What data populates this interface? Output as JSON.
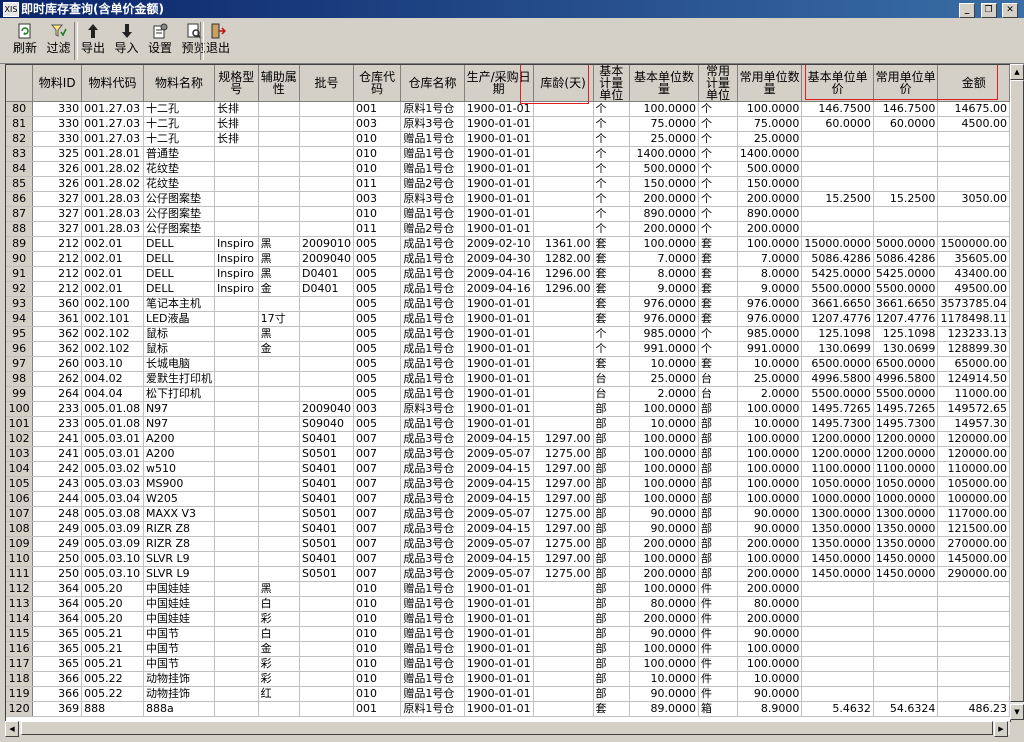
{
  "window": {
    "app_icon": "XIS",
    "title": "即时库存查询(含单价金额)",
    "buttons": {
      "minimize": "_",
      "restore": "❐",
      "close": "✕"
    }
  },
  "toolbar": {
    "refresh": {
      "label": "刷新",
      "icon": "refresh-icon"
    },
    "filter": {
      "label": "过滤",
      "icon": "filter-icon"
    },
    "export": {
      "label": "导出",
      "icon": "export-icon"
    },
    "import": {
      "label": "导入",
      "icon": "import-icon"
    },
    "settings": {
      "label": "设置",
      "icon": "settings-icon"
    },
    "preview": {
      "label": "预览",
      "icon": "preview-icon"
    },
    "exit": {
      "label": "退出",
      "icon": "exit-icon"
    }
  },
  "table": {
    "highlight_color": "#e02020",
    "headers": [
      "物料ID",
      "物料代码",
      "物料名称",
      "规格型号",
      "辅助属性",
      "批号",
      "仓库代码",
      "仓库名称",
      "生产/采购日期",
      "库龄(天)",
      "基本计量单位",
      "基本单位数量",
      "常用计量单位",
      "常用单位数量",
      "基本单位单价",
      "常用单位单价",
      "金额"
    ],
    "rows": [
      [
        "80",
        "330",
        "001.27.03",
        "十二孔",
        "长排",
        "",
        "",
        "001",
        "原料1号仓",
        "1900-01-01",
        "",
        "个",
        "100.0000",
        "个",
        "100.0000",
        "146.7500",
        "146.7500",
        "14675.00"
      ],
      [
        "81",
        "330",
        "001.27.03",
        "十二孔",
        "长排",
        "",
        "",
        "003",
        "原料3号仓",
        "1900-01-01",
        "",
        "个",
        "75.0000",
        "个",
        "75.0000",
        "60.0000",
        "60.0000",
        "4500.00"
      ],
      [
        "82",
        "330",
        "001.27.03",
        "十二孔",
        "长排",
        "",
        "",
        "010",
        "赠品1号仓",
        "1900-01-01",
        "",
        "个",
        "25.0000",
        "个",
        "25.0000",
        "",
        "",
        ""
      ],
      [
        "83",
        "325",
        "001.28.01",
        "普通垫",
        "",
        "",
        "",
        "010",
        "赠品1号仓",
        "1900-01-01",
        "",
        "个",
        "1400.0000",
        "个",
        "1400.0000",
        "",
        "",
        ""
      ],
      [
        "84",
        "326",
        "001.28.02",
        "花纹垫",
        "",
        "",
        "",
        "010",
        "赠品1号仓",
        "1900-01-01",
        "",
        "个",
        "500.0000",
        "个",
        "500.0000",
        "",
        "",
        ""
      ],
      [
        "85",
        "326",
        "001.28.02",
        "花纹垫",
        "",
        "",
        "",
        "011",
        "赠品2号仓",
        "1900-01-01",
        "",
        "个",
        "150.0000",
        "个",
        "150.0000",
        "",
        "",
        ""
      ],
      [
        "86",
        "327",
        "001.28.03",
        "公仔图案垫",
        "",
        "",
        "",
        "003",
        "原料3号仓",
        "1900-01-01",
        "",
        "个",
        "200.0000",
        "个",
        "200.0000",
        "15.2500",
        "15.2500",
        "3050.00"
      ],
      [
        "87",
        "327",
        "001.28.03",
        "公仔图案垫",
        "",
        "",
        "",
        "010",
        "赠品1号仓",
        "1900-01-01",
        "",
        "个",
        "890.0000",
        "个",
        "890.0000",
        "",
        "",
        ""
      ],
      [
        "88",
        "327",
        "001.28.03",
        "公仔图案垫",
        "",
        "",
        "",
        "011",
        "赠品2号仓",
        "1900-01-01",
        "",
        "个",
        "200.0000",
        "个",
        "200.0000",
        "",
        "",
        ""
      ],
      [
        "89",
        "212",
        "002.01",
        "DELL",
        "Inspiro",
        "黑",
        "2009010",
        "005",
        "成品1号仓",
        "2009-02-10",
        "1361.00",
        "套",
        "100.0000",
        "套",
        "100.0000",
        "15000.0000",
        "5000.0000",
        "1500000.00"
      ],
      [
        "90",
        "212",
        "002.01",
        "DELL",
        "Inspiro",
        "黑",
        "2009040",
        "005",
        "成品1号仓",
        "2009-04-30",
        "1282.00",
        "套",
        "7.0000",
        "套",
        "7.0000",
        "5086.4286",
        "5086.4286",
        "35605.00"
      ],
      [
        "91",
        "212",
        "002.01",
        "DELL",
        "Inspiro",
        "黑",
        "D0401",
        "005",
        "成品1号仓",
        "2009-04-16",
        "1296.00",
        "套",
        "8.0000",
        "套",
        "8.0000",
        "5425.0000",
        "5425.0000",
        "43400.00"
      ],
      [
        "92",
        "212",
        "002.01",
        "DELL",
        "Inspiro",
        "金",
        "D0401",
        "005",
        "成品1号仓",
        "2009-04-16",
        "1296.00",
        "套",
        "9.0000",
        "套",
        "9.0000",
        "5500.0000",
        "5500.0000",
        "49500.00"
      ],
      [
        "93",
        "360",
        "002.100",
        "笔记本主机",
        "",
        "",
        "",
        "005",
        "成品1号仓",
        "1900-01-01",
        "",
        "套",
        "976.0000",
        "套",
        "976.0000",
        "3661.6650",
        "3661.6650",
        "3573785.04"
      ],
      [
        "94",
        "361",
        "002.101",
        "LED液晶",
        "",
        "17寸",
        "",
        "005",
        "成品1号仓",
        "1900-01-01",
        "",
        "套",
        "976.0000",
        "套",
        "976.0000",
        "1207.4776",
        "1207.4776",
        "1178498.11"
      ],
      [
        "95",
        "362",
        "002.102",
        "鼠标",
        "",
        "黑",
        "",
        "005",
        "成品1号仓",
        "1900-01-01",
        "",
        "个",
        "985.0000",
        "个",
        "985.0000",
        "125.1098",
        "125.1098",
        "123233.13"
      ],
      [
        "96",
        "362",
        "002.102",
        "鼠标",
        "",
        "金",
        "",
        "005",
        "成品1号仓",
        "1900-01-01",
        "",
        "个",
        "991.0000",
        "个",
        "991.0000",
        "130.0699",
        "130.0699",
        "128899.30"
      ],
      [
        "97",
        "260",
        "003.10",
        "长城电脑",
        "",
        "",
        "",
        "005",
        "成品1号仓",
        "1900-01-01",
        "",
        "套",
        "10.0000",
        "套",
        "10.0000",
        "6500.0000",
        "6500.0000",
        "65000.00"
      ],
      [
        "98",
        "262",
        "004.02",
        "爱默生打印机",
        "",
        "",
        "",
        "005",
        "成品1号仓",
        "1900-01-01",
        "",
        "台",
        "25.0000",
        "台",
        "25.0000",
        "4996.5800",
        "4996.5800",
        "124914.50"
      ],
      [
        "99",
        "264",
        "004.04",
        "松下打印机",
        "",
        "",
        "",
        "005",
        "成品1号仓",
        "1900-01-01",
        "",
        "台",
        "2.0000",
        "台",
        "2.0000",
        "5500.0000",
        "5500.0000",
        "11000.00"
      ],
      [
        "100",
        "233",
        "005.01.08",
        "N97",
        "",
        "",
        "2009040",
        "003",
        "原料3号仓",
        "1900-01-01",
        "",
        "部",
        "100.0000",
        "部",
        "100.0000",
        "1495.7265",
        "1495.7265",
        "149572.65"
      ],
      [
        "101",
        "233",
        "005.01.08",
        "N97",
        "",
        "",
        "S09040",
        "005",
        "成品1号仓",
        "1900-01-01",
        "",
        "部",
        "10.0000",
        "部",
        "10.0000",
        "1495.7300",
        "1495.7300",
        "14957.30"
      ],
      [
        "102",
        "241",
        "005.03.01",
        "A200",
        "",
        "",
        "S0401",
        "007",
        "成品3号仓",
        "2009-04-15",
        "1297.00",
        "部",
        "100.0000",
        "部",
        "100.0000",
        "1200.0000",
        "1200.0000",
        "120000.00"
      ],
      [
        "103",
        "241",
        "005.03.01",
        "A200",
        "",
        "",
        "S0501",
        "007",
        "成品3号仓",
        "2009-05-07",
        "1275.00",
        "部",
        "100.0000",
        "部",
        "100.0000",
        "1200.0000",
        "1200.0000",
        "120000.00"
      ],
      [
        "104",
        "242",
        "005.03.02",
        "w510",
        "",
        "",
        "S0401",
        "007",
        "成品3号仓",
        "2009-04-15",
        "1297.00",
        "部",
        "100.0000",
        "部",
        "100.0000",
        "1100.0000",
        "1100.0000",
        "110000.00"
      ],
      [
        "105",
        "243",
        "005.03.03",
        "MS900",
        "",
        "",
        "S0401",
        "007",
        "成品3号仓",
        "2009-04-15",
        "1297.00",
        "部",
        "100.0000",
        "部",
        "100.0000",
        "1050.0000",
        "1050.0000",
        "105000.00"
      ],
      [
        "106",
        "244",
        "005.03.04",
        "W205",
        "",
        "",
        "S0401",
        "007",
        "成品3号仓",
        "2009-04-15",
        "1297.00",
        "部",
        "100.0000",
        "部",
        "100.0000",
        "1000.0000",
        "1000.0000",
        "100000.00"
      ],
      [
        "107",
        "248",
        "005.03.08",
        "MAXX V3",
        "",
        "",
        "S0501",
        "007",
        "成品3号仓",
        "2009-05-07",
        "1275.00",
        "部",
        "90.0000",
        "部",
        "90.0000",
        "1300.0000",
        "1300.0000",
        "117000.00"
      ],
      [
        "108",
        "249",
        "005.03.09",
        "RIZR Z8",
        "",
        "",
        "S0401",
        "007",
        "成品3号仓",
        "2009-04-15",
        "1297.00",
        "部",
        "90.0000",
        "部",
        "90.0000",
        "1350.0000",
        "1350.0000",
        "121500.00"
      ],
      [
        "109",
        "249",
        "005.03.09",
        "RIZR Z8",
        "",
        "",
        "S0501",
        "007",
        "成品3号仓",
        "2009-05-07",
        "1275.00",
        "部",
        "200.0000",
        "部",
        "200.0000",
        "1350.0000",
        "1350.0000",
        "270000.00"
      ],
      [
        "110",
        "250",
        "005.03.10",
        "SLVR L9",
        "",
        "",
        "S0401",
        "007",
        "成品3号仓",
        "2009-04-15",
        "1297.00",
        "部",
        "100.0000",
        "部",
        "100.0000",
        "1450.0000",
        "1450.0000",
        "145000.00"
      ],
      [
        "111",
        "250",
        "005.03.10",
        "SLVR L9",
        "",
        "",
        "S0501",
        "007",
        "成品3号仓",
        "2009-05-07",
        "1275.00",
        "部",
        "200.0000",
        "部",
        "200.0000",
        "1450.0000",
        "1450.0000",
        "290000.00"
      ],
      [
        "112",
        "364",
        "005.20",
        "中国娃娃",
        "",
        "黑",
        "",
        "010",
        "赠品1号仓",
        "1900-01-01",
        "",
        "部",
        "100.0000",
        "件",
        "200.0000",
        "",
        "",
        ""
      ],
      [
        "113",
        "364",
        "005.20",
        "中国娃娃",
        "",
        "白",
        "",
        "010",
        "赠品1号仓",
        "1900-01-01",
        "",
        "部",
        "80.0000",
        "件",
        "80.0000",
        "",
        "",
        ""
      ],
      [
        "114",
        "364",
        "005.20",
        "中国娃娃",
        "",
        "彩",
        "",
        "010",
        "赠品1号仓",
        "1900-01-01",
        "",
        "部",
        "200.0000",
        "件",
        "200.0000",
        "",
        "",
        ""
      ],
      [
        "115",
        "365",
        "005.21",
        "中国节",
        "",
        "白",
        "",
        "010",
        "赠品1号仓",
        "1900-01-01",
        "",
        "部",
        "90.0000",
        "件",
        "90.0000",
        "",
        "",
        ""
      ],
      [
        "116",
        "365",
        "005.21",
        "中国节",
        "",
        "金",
        "",
        "010",
        "赠品1号仓",
        "1900-01-01",
        "",
        "部",
        "100.0000",
        "件",
        "100.0000",
        "",
        "",
        ""
      ],
      [
        "117",
        "365",
        "005.21",
        "中国节",
        "",
        "彩",
        "",
        "010",
        "赠品1号仓",
        "1900-01-01",
        "",
        "部",
        "100.0000",
        "件",
        "100.0000",
        "",
        "",
        ""
      ],
      [
        "118",
        "366",
        "005.22",
        "动物挂饰",
        "",
        "彩",
        "",
        "010",
        "赠品1号仓",
        "1900-01-01",
        "",
        "部",
        "10.0000",
        "件",
        "10.0000",
        "",
        "",
        ""
      ],
      [
        "119",
        "366",
        "005.22",
        "动物挂饰",
        "",
        "红",
        "",
        "010",
        "赠品1号仓",
        "1900-01-01",
        "",
        "部",
        "90.0000",
        "件",
        "90.0000",
        "",
        "",
        ""
      ],
      [
        "120",
        "369",
        "888",
        "888a",
        "",
        "",
        "",
        "001",
        "原料1号仓",
        "1900-01-01",
        "",
        "套",
        "89.0000",
        "箱",
        "8.9000",
        "5.4632",
        "54.6324",
        "486.23"
      ]
    ]
  }
}
